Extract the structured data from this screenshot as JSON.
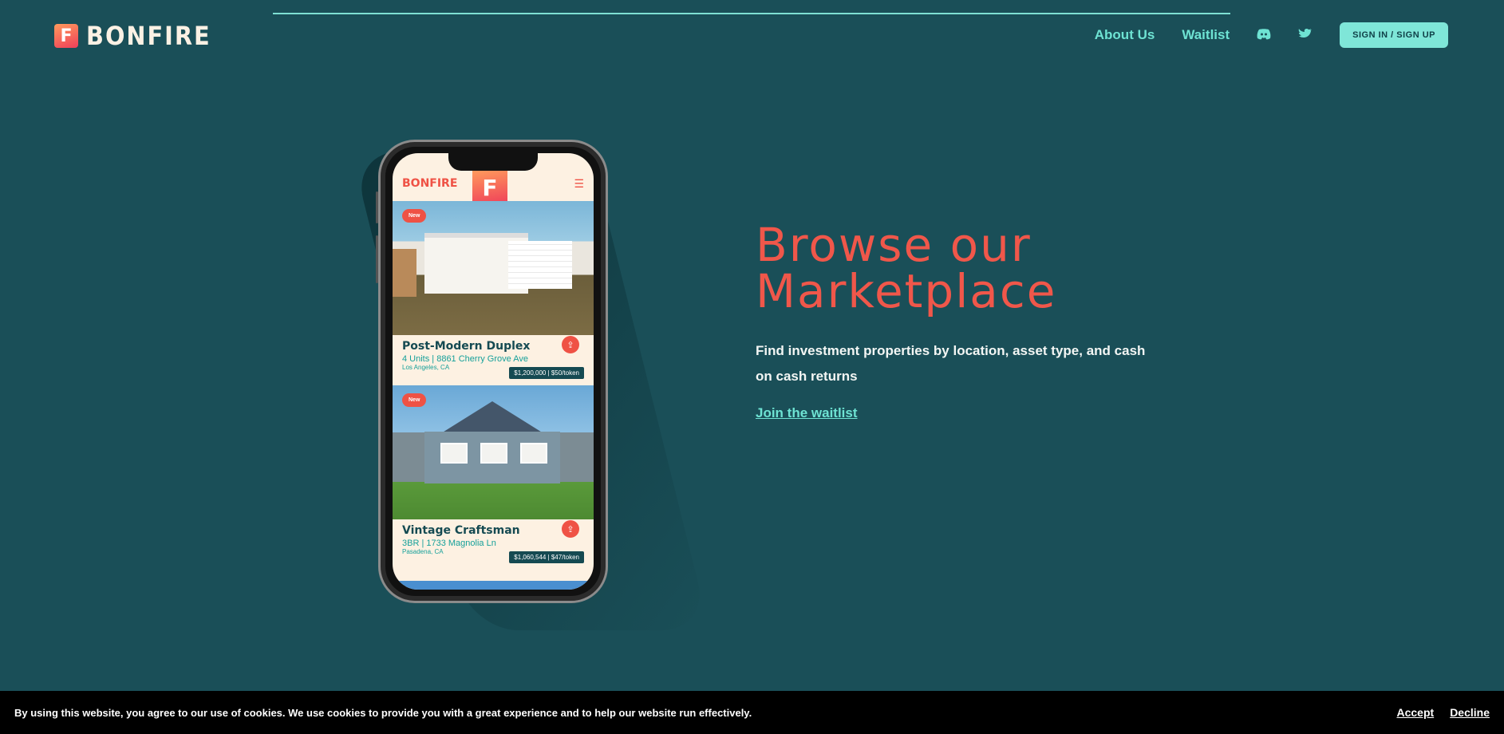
{
  "header": {
    "logo_mark": "F",
    "logo_text": "BONFIRE",
    "nav": {
      "about": "About Us",
      "waitlist": "Waitlist",
      "discord_icon": "discord-icon",
      "twitter_icon": "twitter-icon",
      "signin": "SIGN IN / SIGN UP"
    }
  },
  "phone_app": {
    "brand": "BONFIRE",
    "mark": "F",
    "menu_icon": "menu-icon",
    "listings": [
      {
        "badge": "New",
        "title": "Post-Modern Duplex",
        "subtitle": "4 Units | 8861 Cherry Grove Ave",
        "city": "Los Angeles, CA",
        "price": "$1,200,000 | $50/token"
      },
      {
        "badge": "New",
        "title": "Vintage Craftsman",
        "subtitle": "3BR | 1733 Magnolia Ln",
        "city": "Pasadena, CA",
        "price": "$1,060,544 | $47/token"
      }
    ]
  },
  "hero": {
    "title_line1": "Browse our",
    "title_line2": "Marketplace",
    "subtitle": "Find investment properties by location, asset type, and cash on cash returns",
    "cta": "Join the waitlist"
  },
  "cookie": {
    "text": "By using this website, you agree to our use of cookies. We use cookies to provide you with a great experience and to help our website run effectively.",
    "accept": "Accept",
    "decline": "Decline"
  },
  "colors": {
    "background": "#1a4f58",
    "accent": "#6ee3d3",
    "brand_red": "#f0574a",
    "cream": "#fdf1e2"
  }
}
